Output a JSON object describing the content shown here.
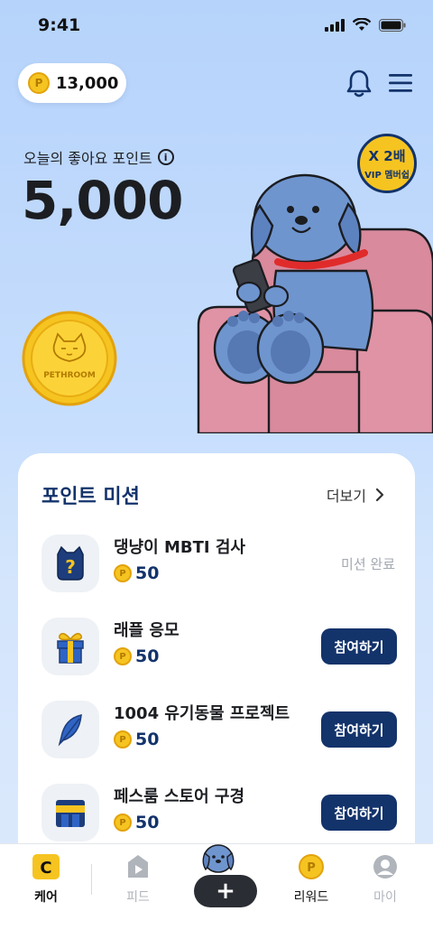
{
  "status": {
    "time": "9:41"
  },
  "header": {
    "points": "13,000"
  },
  "today": {
    "label": "오늘의 좋아요 포인트",
    "value": "5,000"
  },
  "vip": {
    "multiplier": "X 2배",
    "label": "VIP 멤버쉽"
  },
  "coin": {
    "brand": "PETHROOM",
    "symbol": "P"
  },
  "missions": {
    "title": "포인트 미션",
    "more_label": "더보기",
    "items": [
      {
        "name": "댕냥이 MBTI 검사",
        "reward": "50",
        "status": "미션 완료",
        "icon": "cat-question-icon"
      },
      {
        "name": "래플 응모",
        "reward": "50",
        "action": "참여하기",
        "icon": "gift-icon"
      },
      {
        "name": "1004 유기동물 프로젝트",
        "reward": "50",
        "action": "참여하기",
        "icon": "feather-icon"
      },
      {
        "name": "페스룸 스토어 구경",
        "reward": "50",
        "action": "참여하기",
        "icon": "store-icon"
      }
    ]
  },
  "tabs": {
    "care": "케어",
    "feed": "피드",
    "plus": "+",
    "reward": "리워드",
    "my": "마이"
  },
  "colors": {
    "navy": "#13336b",
    "gold": "#f6c421",
    "bg": "#b6d3fb"
  }
}
